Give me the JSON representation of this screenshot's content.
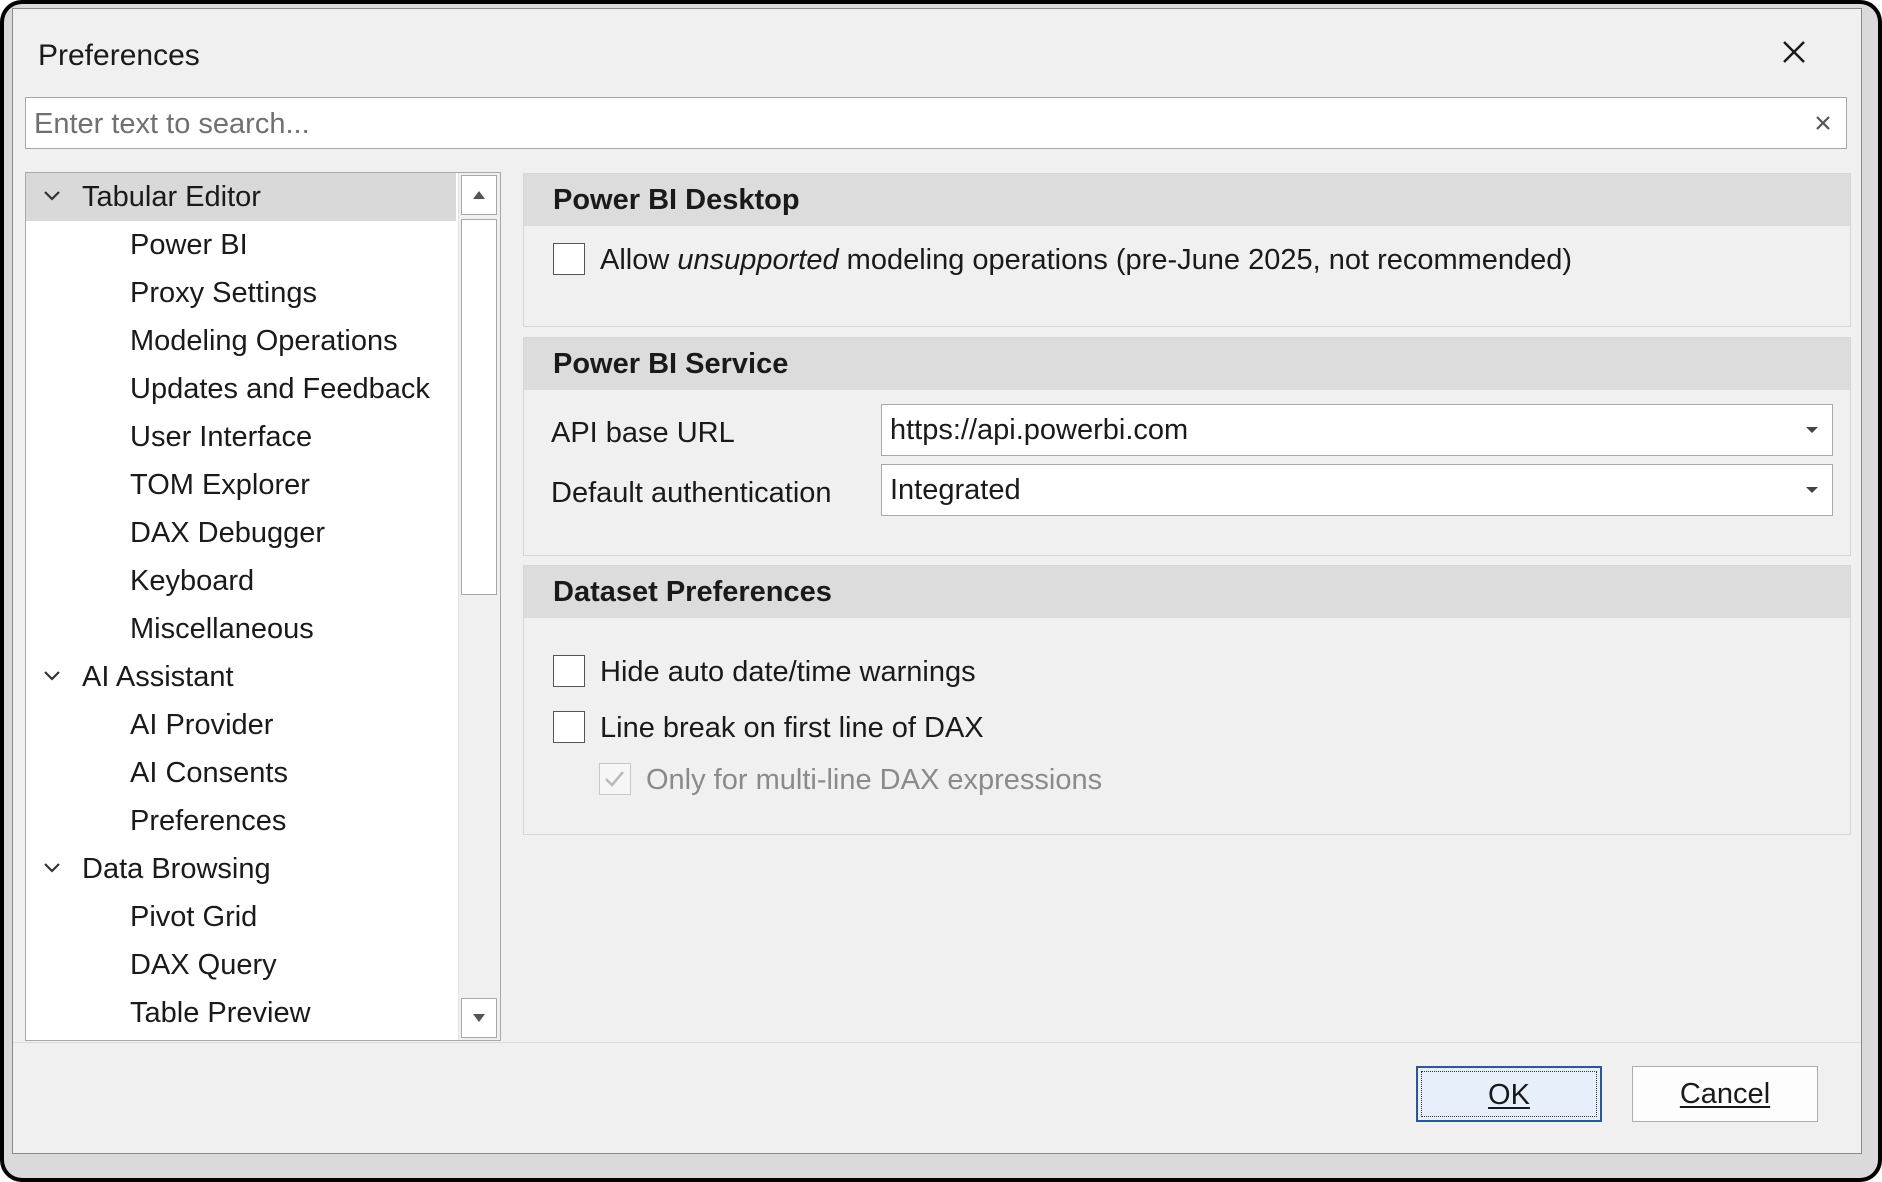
{
  "window": {
    "title": "Preferences",
    "close_icon": "close-icon"
  },
  "search": {
    "placeholder": "Enter text to search...",
    "value": "",
    "clear_icon": "clear-icon"
  },
  "tree": {
    "items": [
      {
        "label": "Tabular Editor",
        "level": 0,
        "expanded": true,
        "selected": true
      },
      {
        "label": "Power BI",
        "level": 1
      },
      {
        "label": "Proxy Settings",
        "level": 1
      },
      {
        "label": "Modeling Operations",
        "level": 1
      },
      {
        "label": "Updates and Feedback",
        "level": 1
      },
      {
        "label": "User Interface",
        "level": 1
      },
      {
        "label": "TOM Explorer",
        "level": 1
      },
      {
        "label": "DAX Debugger",
        "level": 1
      },
      {
        "label": "Keyboard",
        "level": 1
      },
      {
        "label": "Miscellaneous",
        "level": 1
      },
      {
        "label": "AI Assistant",
        "level": 0,
        "expanded": true
      },
      {
        "label": "AI Provider",
        "level": 1
      },
      {
        "label": "AI Consents",
        "level": 1
      },
      {
        "label": "Preferences",
        "level": 1
      },
      {
        "label": "Data Browsing",
        "level": 0,
        "expanded": true
      },
      {
        "label": "Pivot Grid",
        "level": 1
      },
      {
        "label": "DAX Query",
        "level": 1
      },
      {
        "label": "Table Preview",
        "level": 1
      }
    ]
  },
  "power_bi_desktop": {
    "header": "Power BI Desktop",
    "allow_unsupported": {
      "prefix": "Allow ",
      "emphasis": "unsupported",
      "suffix": " modeling operations (pre-June 2025, not recommended)",
      "checked": false
    }
  },
  "power_bi_service": {
    "header": "Power BI Service",
    "api_base_url_label": "API base URL",
    "api_base_url_value": "https://api.powerbi.com",
    "default_auth_label": "Default authentication",
    "default_auth_value": "Integrated"
  },
  "dataset_preferences": {
    "header": "Dataset Preferences",
    "hide_auto_date": {
      "label": "Hide auto date/time warnings",
      "checked": false
    },
    "line_break_first": {
      "label": "Line break on first line of DAX",
      "checked": false
    },
    "only_multiline": {
      "label": "Only for multi-line DAX expressions",
      "checked": true,
      "disabled": true
    }
  },
  "footer": {
    "ok_label": "OK",
    "cancel_label": "Cancel"
  },
  "colors": {
    "dialog_bg": "#f0f0f0",
    "group_header_bg": "#dcdcdc",
    "selected_item_bg": "#d9d9d9",
    "ok_border": "#2b5797"
  }
}
